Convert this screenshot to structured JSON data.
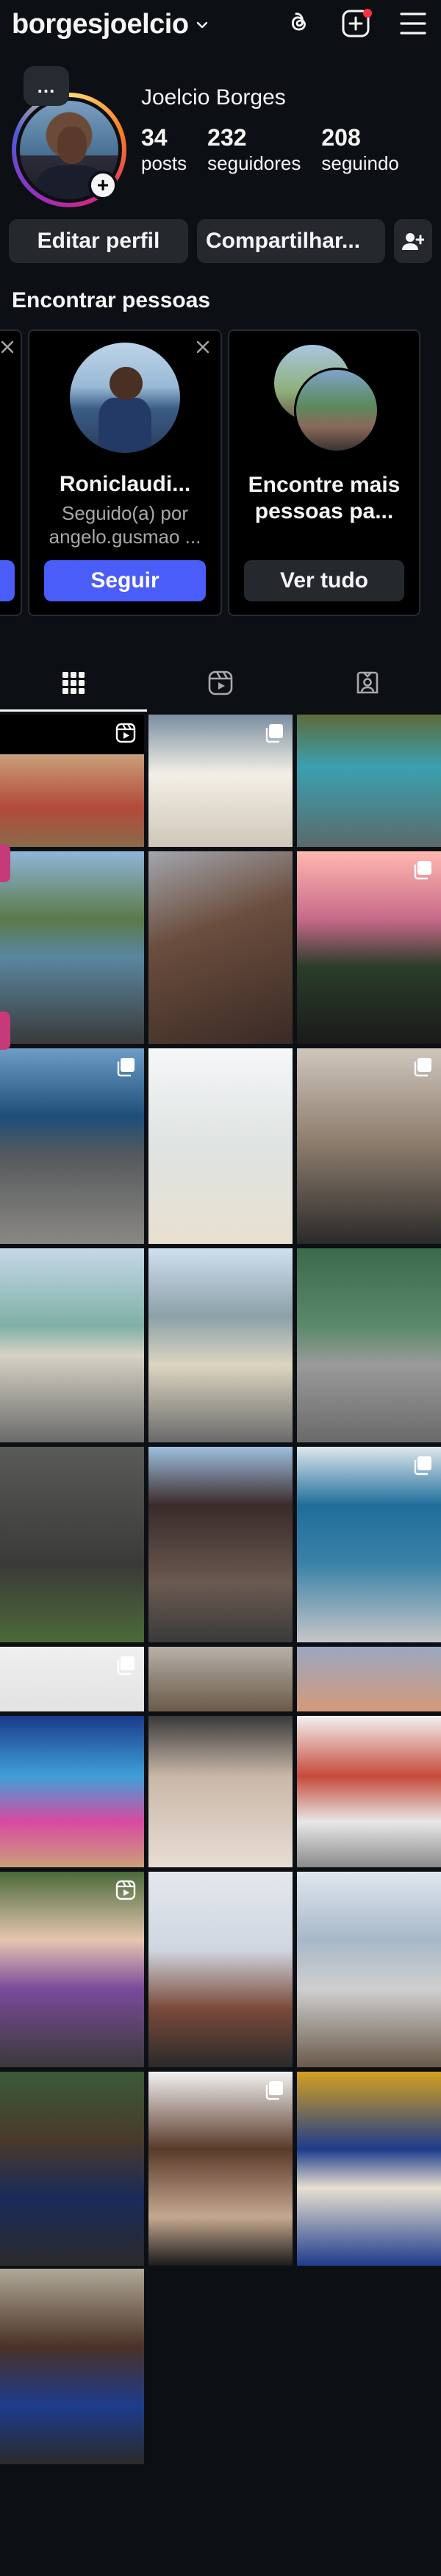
{
  "header": {
    "username": "borgesjoelcio",
    "icons": [
      "chevron-down-icon",
      "threads-icon",
      "new-post-icon",
      "menu-icon"
    ],
    "notification_dot_color": "#ff3040"
  },
  "profile": {
    "note": "...",
    "full_name": "Joelcio Borges",
    "stats": [
      {
        "num": "34",
        "label": "posts"
      },
      {
        "num": "232",
        "label": "seguidores"
      },
      {
        "num": "208",
        "label": "seguindo"
      }
    ]
  },
  "buttons": {
    "edit": "Editar perfil",
    "share": "Compartilhar...",
    "add_user_icon": "add-user-icon"
  },
  "suggestions": {
    "title": "Encontrar pessoas",
    "cards": [
      {
        "name": "Roniclaudi...",
        "sub1": "Seguido(a) por",
        "sub2": "angelo.gusmao ...",
        "action": "Seguir"
      }
    ],
    "more": {
      "title": "Encontre mais pessoas pa...",
      "action": "Ver tudo"
    }
  },
  "tabs": [
    "grid-icon",
    "reels-icon",
    "tagged-icon"
  ],
  "grid": {
    "columns": 3,
    "accent": "#4a5df9"
  }
}
